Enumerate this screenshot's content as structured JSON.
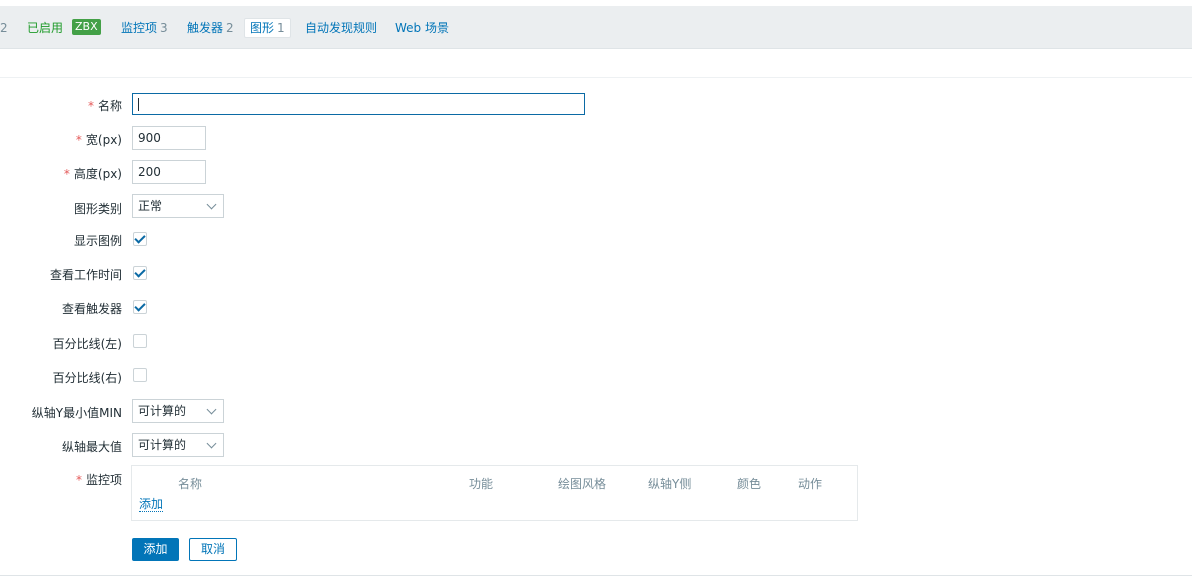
{
  "nav": {
    "prefix_count": "2",
    "enabled_label": "已启用",
    "zbx_badge": "ZBX",
    "items_label": "监控项",
    "items_count": "3",
    "triggers_label": "触发器",
    "triggers_count": "2",
    "graphs_label": "图形",
    "graphs_count": "1",
    "discovery_label": "自动发现规则",
    "web_label": "Web 场景"
  },
  "form": {
    "name_label": "名称",
    "name_value": "",
    "width_label": "宽(px)",
    "width_value": "900",
    "height_label": "高度(px)",
    "height_value": "200",
    "graph_type_label": "图形类别",
    "graph_type_value": "正常",
    "show_legend_label": "显示图例",
    "show_legend_checked": true,
    "show_working_time_label": "查看工作时间",
    "show_working_time_checked": true,
    "show_triggers_label": "查看触发器",
    "show_triggers_checked": true,
    "percentile_left_label": "百分比线(左)",
    "percentile_left_checked": false,
    "percentile_right_label": "百分比线(右)",
    "percentile_right_checked": false,
    "ymin_label": "纵轴Y最小值MIN",
    "ymin_value": "可计算的",
    "ymax_label": "纵轴最大值",
    "ymax_value": "可计算的",
    "items_label": "监控项"
  },
  "items_table": {
    "columns": [
      "名称",
      "功能",
      "绘图风格",
      "纵轴Y侧",
      "颜色",
      "动作"
    ],
    "add_link": "添加"
  },
  "buttons": {
    "add": "添加",
    "cancel": "取消"
  },
  "colors": {
    "accent": "#0275b8",
    "enabled": "#1f9b2a",
    "required": "#e45959"
  }
}
